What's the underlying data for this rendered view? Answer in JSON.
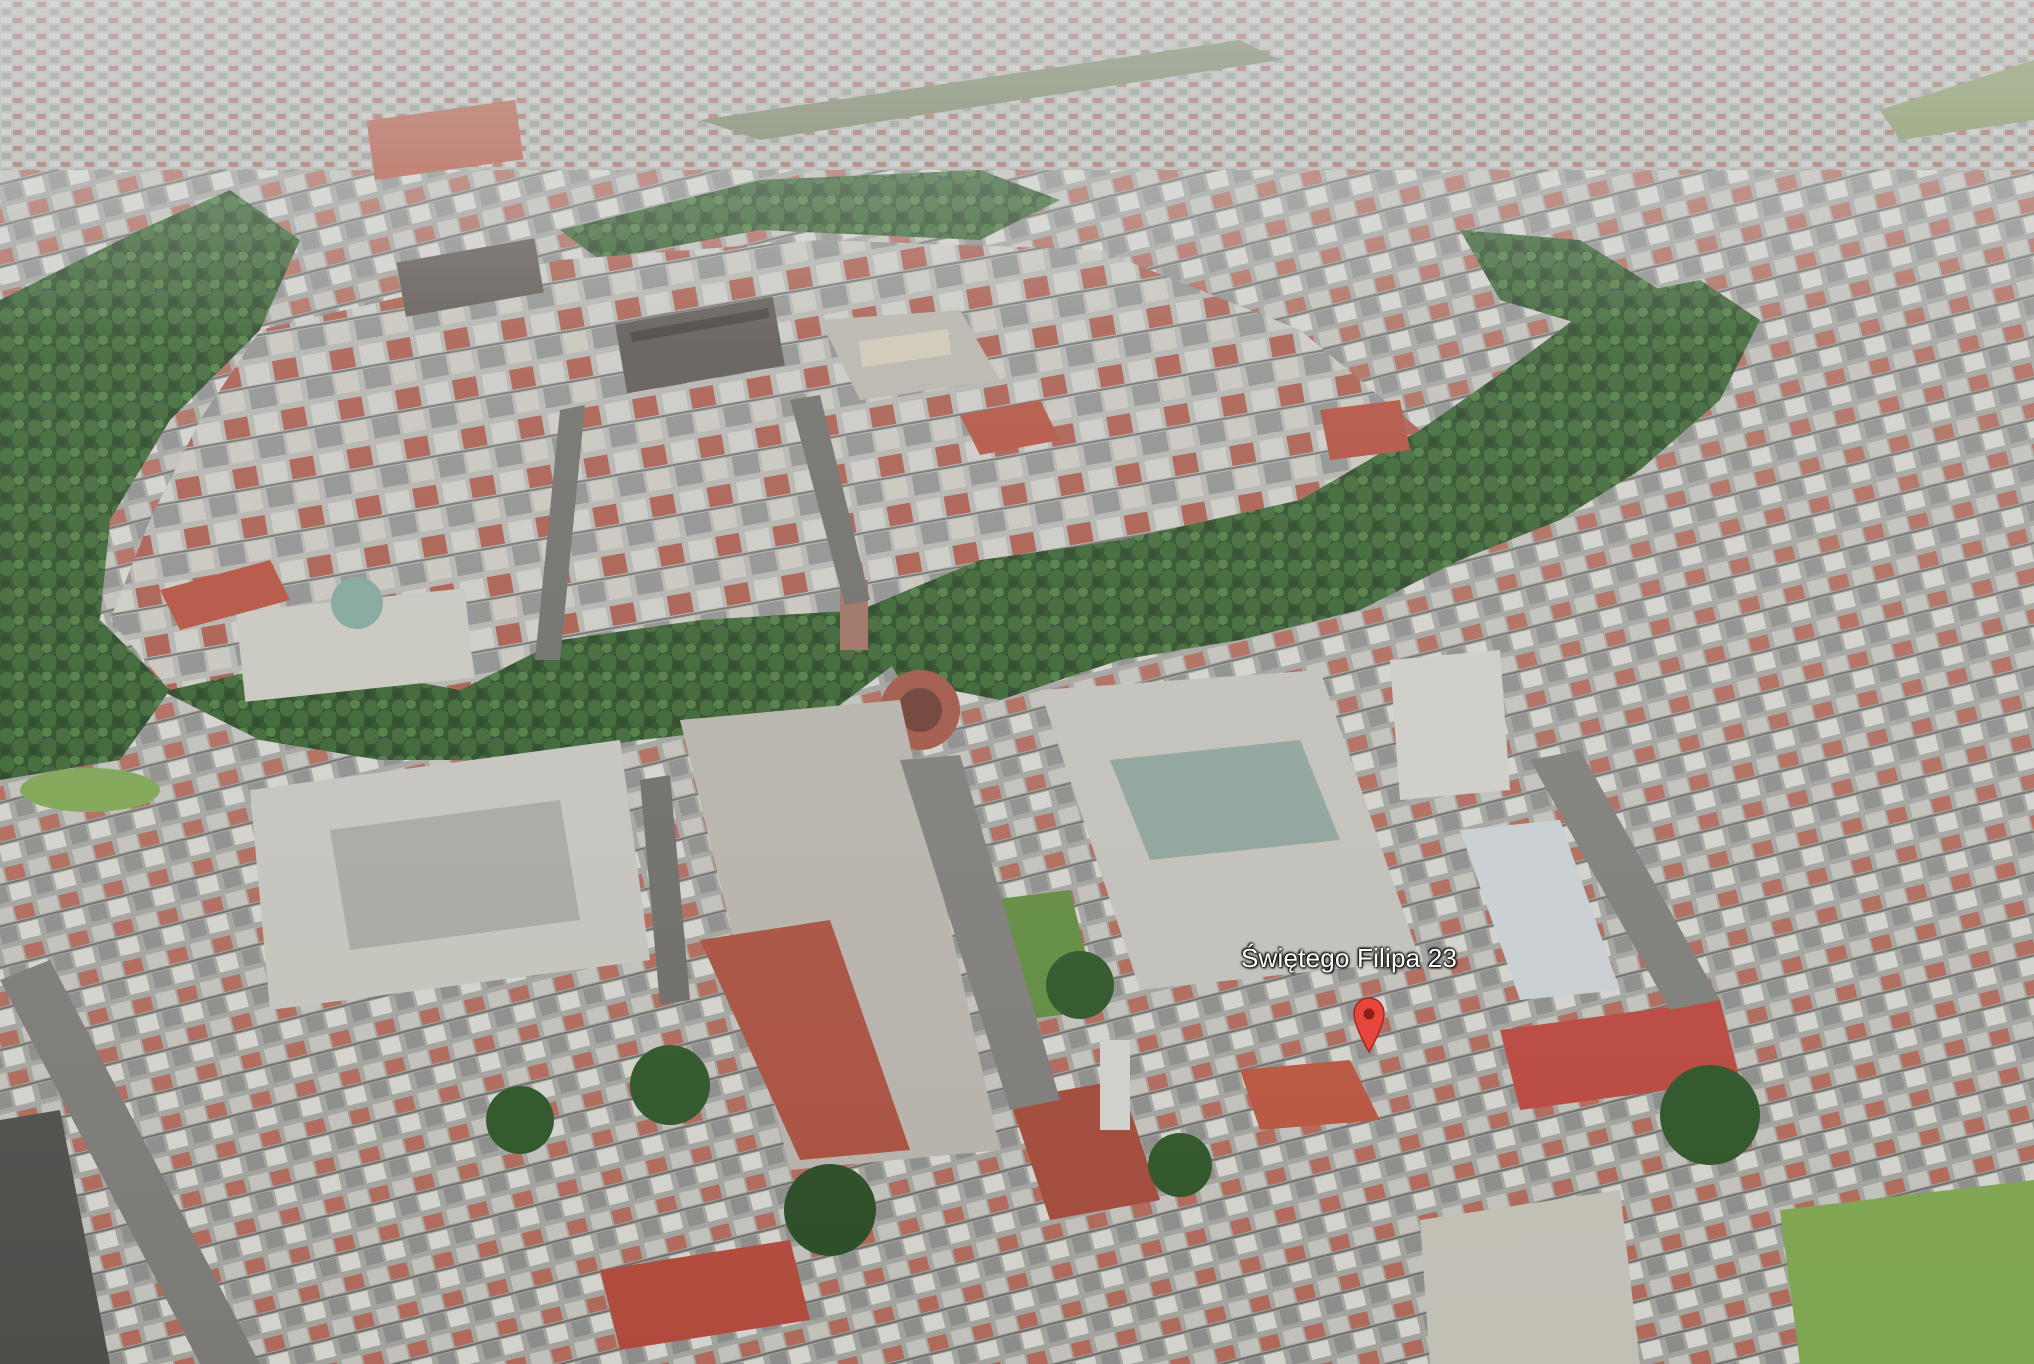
{
  "map": {
    "view": "3d-satellite",
    "pin": {
      "label": "Świętego Filipa 23",
      "icon": "map-pin-icon",
      "color": "#e8453c"
    },
    "colors": {
      "tree": "#2f5128",
      "roof_red": "#b65a48",
      "roof_grey": "#9a9c9a",
      "lawn": "#7ea550",
      "street": "#7b7a76"
    }
  }
}
